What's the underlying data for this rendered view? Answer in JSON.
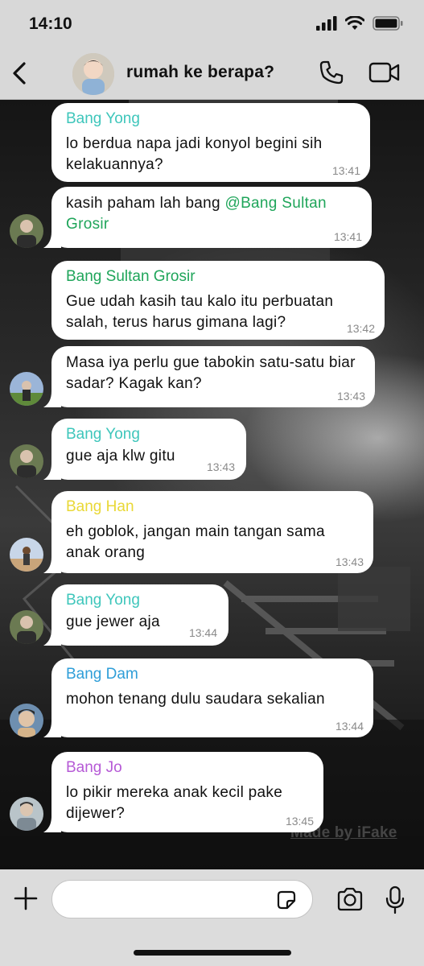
{
  "status_bar": {
    "time": "14:10"
  },
  "header": {
    "title": "rumah ke berapa?"
  },
  "messages": [
    {
      "sender": "Bang Yong",
      "sender_color": "#3ec6bb",
      "text": "lo berdua napa jadi konyol begini sih kelakuannya?",
      "time": "13:41"
    },
    {
      "text_before": "kasih paham lah bang ",
      "mention": "@Bang Sultan Grosir",
      "time": "13:41"
    },
    {
      "sender": "Bang Sultan Grosir",
      "sender_color": "#1fa55a",
      "text": "Gue udah kasih tau kalo itu perbuatan salah, terus harus gimana lagi?",
      "time": "13:42"
    },
    {
      "text": "Masa iya perlu gue tabokin satu-satu biar sadar? Kagak kan?",
      "time": "13:43"
    },
    {
      "sender": "Bang Yong",
      "sender_color": "#3ec6bb",
      "text": "gue aja klw gitu",
      "time": "13:43"
    },
    {
      "sender": "Bang Han",
      "sender_color": "#e9d836",
      "text": "eh goblok, jangan main tangan sama anak orang",
      "time": "13:43"
    },
    {
      "sender": "Bang Yong",
      "sender_color": "#3ec6bb",
      "text": "gue jewer aja",
      "time": "13:44"
    },
    {
      "sender": "Bang Dam",
      "sender_color": "#2f9ed8",
      "text": "mohon tenang dulu saudara sekalian",
      "time": "13:44"
    },
    {
      "sender": "Bang Jo",
      "sender_color": "#b65ad6",
      "text": "lo pikir mereka anak kecil pake dijewer?",
      "time": "13:45"
    }
  ],
  "watermark": "Made by iFake",
  "composer": {
    "placeholder": ""
  },
  "icons": {
    "back": "chevron-left-icon",
    "call": "phone-icon",
    "video": "video-camera-icon",
    "plus": "plus-icon",
    "sticker": "sticker-icon",
    "camera": "camera-icon",
    "mic": "microphone-icon"
  },
  "colors": {
    "bar_bg": "#d8d8d8",
    "bubble_bg": "#ffffff",
    "time_text": "#8a8a8a"
  }
}
